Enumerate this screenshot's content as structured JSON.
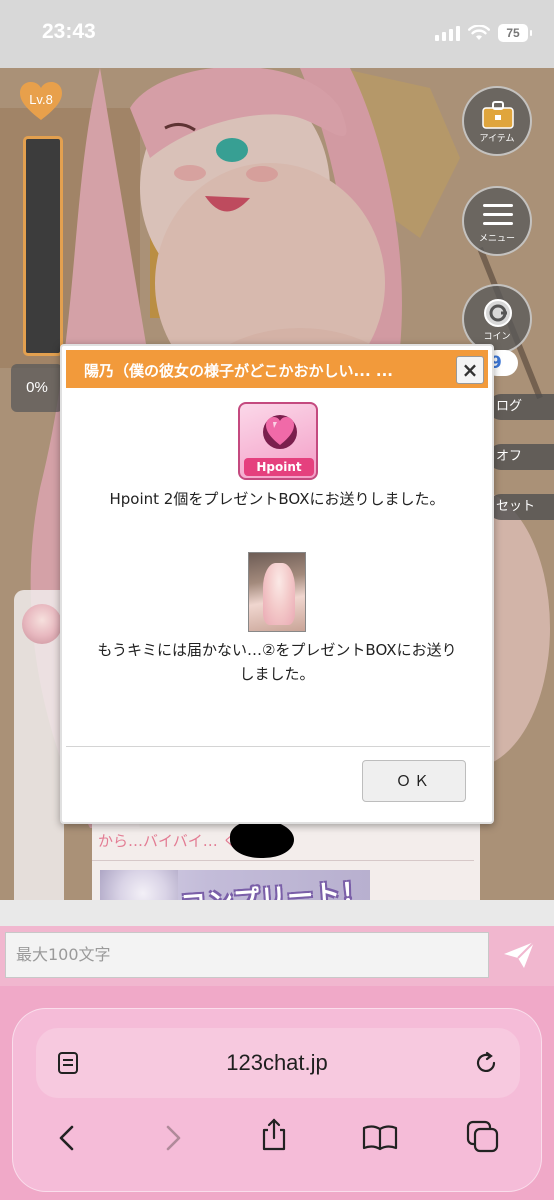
{
  "status_bar": {
    "time": "23:43",
    "battery_level": "75",
    "signal_icon": "cellular-signal-icon",
    "wifi_icon": "wifi-icon"
  },
  "hud": {
    "level": "Lv.8",
    "gauge_percent": "0%",
    "gauge_fill": 0,
    "item_button": "アイテム",
    "menu_button": "メニュー",
    "coin_button": "コイン",
    "coin_count": "9",
    "side_log": "ログ",
    "side_off": "オフ",
    "side_reset": "セット"
  },
  "chat": {
    "message_text": "から…バイバイ…          くん…♥",
    "complete_banner": "コンプリート！"
  },
  "modal": {
    "title": "陽乃（僕の彼女の様子がどこかおかしい... ...",
    "close_label": "×",
    "hpoint_label": "Hpoint",
    "message1": "Hpoint 2個をプレゼントBOXにお送りしました。",
    "message2": "もうキミには届かない…②をプレゼントBOXにお送りしました。",
    "ok_label": "ＯＫ"
  },
  "input": {
    "placeholder": "最大100文字",
    "send_icon": "send-paper-plane-icon"
  },
  "browser": {
    "url": "123chat.jp",
    "reader_icon": "reader-mode-icon",
    "reload_icon": "reload-icon",
    "back_icon": "back-chevron-icon",
    "forward_icon": "forward-chevron-icon",
    "share_icon": "share-icon",
    "bookmarks_icon": "bookmarks-icon",
    "tabs_icon": "tabs-icon"
  },
  "colors": {
    "header_orange": "#f29a3b",
    "chat_pink": "#e37d94",
    "browser_pink": "#f0a9c8"
  }
}
